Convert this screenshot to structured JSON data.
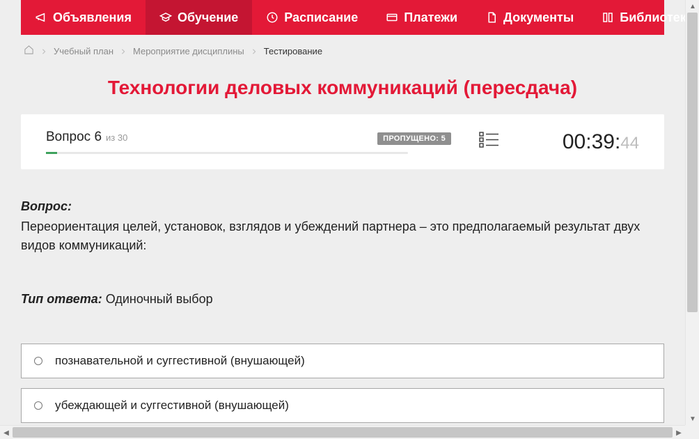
{
  "nav": {
    "items": [
      {
        "label": "Объявления",
        "icon": "megaphone-icon"
      },
      {
        "label": "Обучение",
        "icon": "graduation-cap-icon",
        "active": true
      },
      {
        "label": "Расписание",
        "icon": "clock-icon"
      },
      {
        "label": "Платежи",
        "icon": "credit-card-icon"
      },
      {
        "label": "Документы",
        "icon": "document-icon"
      },
      {
        "label": "Библиотека",
        "icon": "library-icon",
        "has_dropdown": true
      }
    ]
  },
  "breadcrumb": {
    "items": [
      {
        "label": "Учебный план"
      },
      {
        "label": "Мероприятие дисциплины"
      },
      {
        "label": "Тестирование",
        "current": true
      }
    ]
  },
  "title": "Технологии деловых коммуникаций (пересдача)",
  "status": {
    "question_word": "Вопрос",
    "question_num": "6",
    "of_word": "из",
    "question_total": "30",
    "skipped_label": "ПРОПУЩЕНО: 5",
    "progress_percent": 3,
    "timer_main": "00:39:",
    "timer_dec": "44"
  },
  "question": {
    "heading": "Вопрос:",
    "text": "Переориентация целей, установок, взглядов и убеждений партнера – это предполагаемый результат двух видов коммуникаций:",
    "answer_type_label": "Тип ответа:",
    "answer_type_value": "Одиночный выбор"
  },
  "options": [
    {
      "text": "познавательной и суггестивной (внушающей)"
    },
    {
      "text": "убеждающей и суггестивной (внушающей)"
    }
  ],
  "colors": {
    "primary": "#e31937",
    "primary_dark": "#c41532",
    "badge_bg": "#8f8f8f"
  }
}
